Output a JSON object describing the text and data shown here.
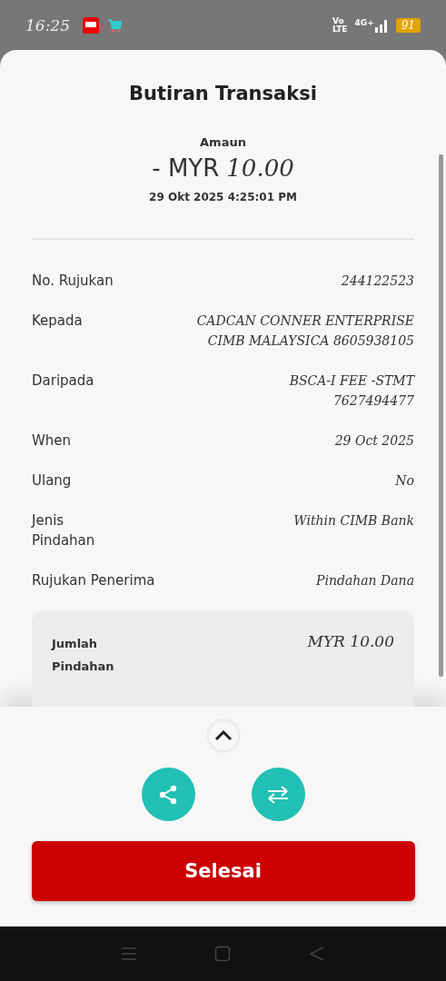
{
  "status_bar": {
    "time": "16:25",
    "volte_top": "Vo",
    "volte_bottom": "LTE",
    "network": "4G+",
    "battery": "91"
  },
  "title": "Butiran Transaksi",
  "amount": {
    "label": "Amaun",
    "value_prefix": "- MYR",
    "value": "10.00",
    "datetime": "29 Okt 2025 4:25:01 PM"
  },
  "details": [
    {
      "label": "No. Rujukan",
      "value": "244122523"
    },
    {
      "label": "Kepada",
      "value": "CADCAN CONNER ENTERPRISE\nCIMB MALAYSICA 8605938105"
    },
    {
      "label": "Daripada",
      "value": "BSCA-I FEE -STMT\n7627494477"
    },
    {
      "label": "When",
      "value": "29 Oct 2025"
    },
    {
      "label": "Ulang",
      "value": "No"
    },
    {
      "label": "Jenis Pindahan",
      "value": "Within CIMB Bank"
    },
    {
      "label": "Rujukan Penerima",
      "value": "Pindahan Dana"
    }
  ],
  "total": {
    "label": "Jumlah Pindahan",
    "value": "MYR 10.00"
  },
  "done_button": "Selesai"
}
